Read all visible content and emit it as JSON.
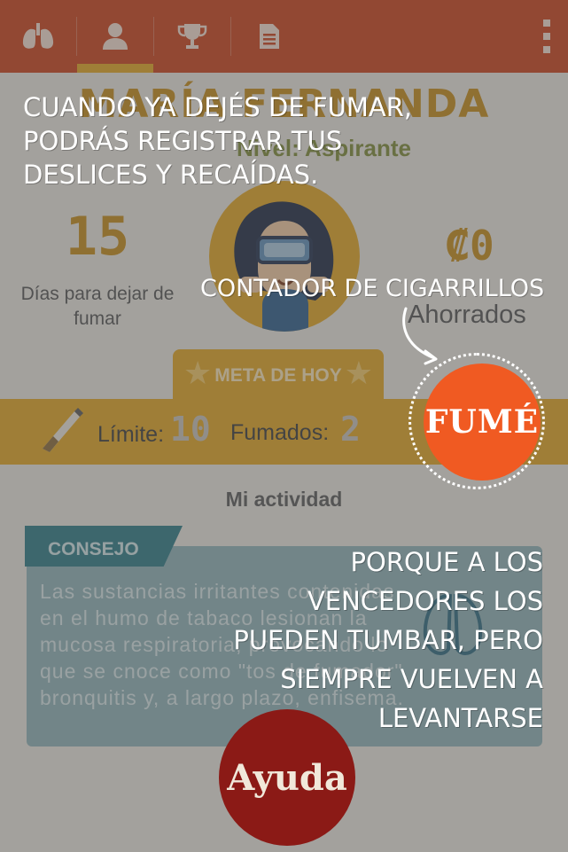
{
  "nav": {
    "tabs": [
      {
        "icon": "lungs-icon",
        "active": false
      },
      {
        "icon": "profile-icon",
        "active": true
      },
      {
        "icon": "trophy-icon",
        "active": false
      },
      {
        "icon": "document-icon",
        "active": false
      }
    ],
    "menu_icon": "overflow-menu-icon"
  },
  "profile": {
    "name": "MARÍA FERNANDA",
    "level": "Nivel: Aspirante",
    "days_value": "15",
    "days_label": "Días para dejar de fumar",
    "saved_value": "₡0",
    "saved_label": "Ahorrados"
  },
  "goal": {
    "tab_label": "META DE HOY",
    "limit_label": "Límite:",
    "limit_value": "10",
    "smoked_label": "Fumados:",
    "smoked_value": "2"
  },
  "activity_label": "Mi actividad",
  "tip": {
    "title": "CONSEJO",
    "text": "Las sustancias irritantes contenidas en el humo de tabaco lesionan la mucosa respiratoria, provocando lo que se cnoce como \"tos de fumador\", bronquitis y, a largo plazo, enfisema."
  },
  "overlay": {
    "hint_relapse": "CUANDO YA DEJÉS DE FUMAR, PODRÁS REGISTRAR TUS DESLICES Y RECAÍDAS.",
    "hint_counter": "CONTADOR DE CIGARRILLOS",
    "hint_motivation": "PORQUE A LOS VENCEDORES LOS PUEDEN TUMBAR, PERO SIEMPRE VUELVEN A LEVANTARSE",
    "smoked_button": "FUMÉ",
    "help_button": "Ayuda"
  },
  "colors": {
    "topbar": "#c9421d",
    "accent": "#e0a423",
    "smoked_button": "#f05a22",
    "help_button": "#8b1a16",
    "tip_card": "#8fb1b6"
  }
}
